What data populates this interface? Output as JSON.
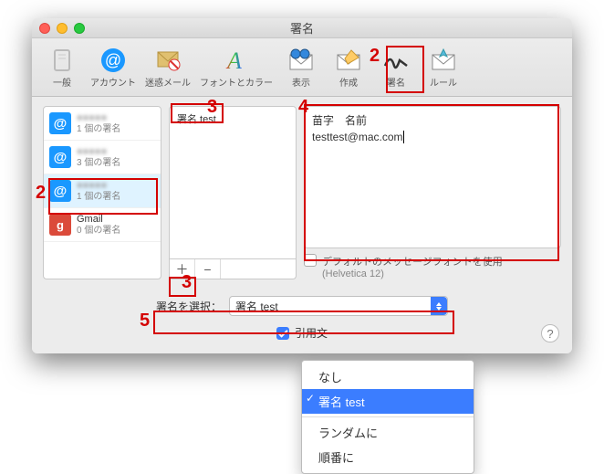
{
  "window": {
    "title": "署名"
  },
  "toolbar": [
    {
      "key": "general",
      "label": "一般"
    },
    {
      "key": "accounts",
      "label": "アカウント"
    },
    {
      "key": "junk",
      "label": "迷惑メール"
    },
    {
      "key": "fonts",
      "label": "フォントとカラー"
    },
    {
      "key": "viewing",
      "label": "表示"
    },
    {
      "key": "composing",
      "label": "作成"
    },
    {
      "key": "signatures",
      "label": "署名"
    },
    {
      "key": "rules",
      "label": "ルール"
    }
  ],
  "accounts": [
    {
      "name_hidden": true,
      "name": "●●●●●",
      "sub": "1 個の署名",
      "icon": "blue"
    },
    {
      "name_hidden": true,
      "name": "●●●●●",
      "sub": "3 個の署名",
      "icon": "blue"
    },
    {
      "name_hidden": true,
      "name": "●●●●●",
      "sub": "1 個の署名",
      "icon": "blue",
      "selected": true
    },
    {
      "name_hidden": false,
      "name": "Gmail",
      "sub": "0 個の署名",
      "icon": "red"
    }
  ],
  "sig_list": {
    "item": "署名 test"
  },
  "content": {
    "line1": "苗字　名前",
    "line2": "testtest@mac.com"
  },
  "default_font": {
    "label": "デフォルトのメッセージフォントを使用",
    "hint": "(Helvetica 12)"
  },
  "select": {
    "label": "署名を選択：",
    "value": "署名 test"
  },
  "include": {
    "label_fragment": "引用文"
  },
  "popup": {
    "items": [
      "なし",
      "署名 test",
      "ランダムに",
      "順番に"
    ],
    "selected_index": 1
  },
  "annotations": {
    "n2a": "2",
    "n2b": "2",
    "n3a": "3",
    "n3b": "3",
    "n4": "4",
    "n5": "5"
  }
}
